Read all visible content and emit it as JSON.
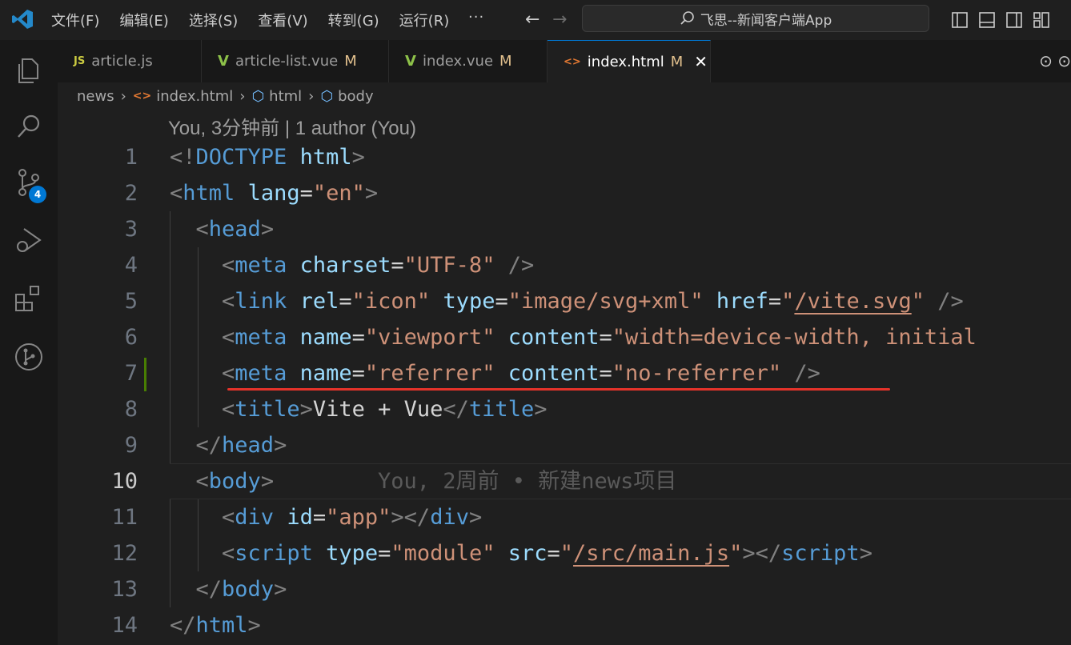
{
  "menu": [
    "文件(F)",
    "编辑(E)",
    "选择(S)",
    "查看(V)",
    "转到(G)",
    "运行(R)"
  ],
  "menu_more": "···",
  "search_text": "飞思--新闻客户端App",
  "activity_badge": "4",
  "tabs": [
    {
      "label": "article.js",
      "icon": "JS",
      "modified": ""
    },
    {
      "label": "article-list.vue",
      "icon": "V",
      "modified": "M"
    },
    {
      "label": "index.vue",
      "icon": "V",
      "modified": "M"
    },
    {
      "label": "index.html",
      "icon": "<>",
      "modified": "M"
    }
  ],
  "breadcrumb": [
    "news",
    "index.html",
    "html",
    "body"
  ],
  "codelens": "You, 3分钟前 | 1 author (You)",
  "blame": "You, 2周前 • 新建news项目",
  "line_numbers": [
    "1",
    "2",
    "3",
    "4",
    "5",
    "6",
    "7",
    "8",
    "9",
    "10",
    "11",
    "12",
    "13",
    "14"
  ],
  "colors": {
    "accent": "#0078d4",
    "annotation_underline": "#e5332a",
    "git_added": "#487e02"
  }
}
